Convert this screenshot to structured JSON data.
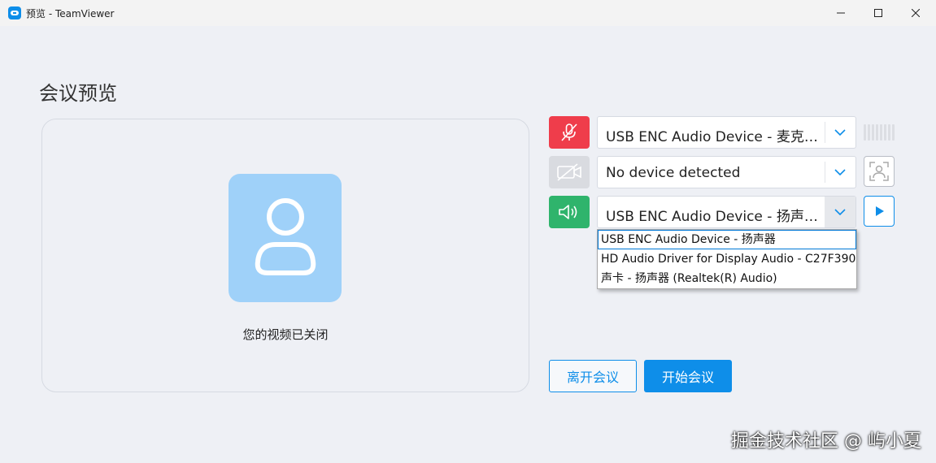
{
  "window": {
    "title": "预览 - TeamViewer"
  },
  "page": {
    "title": "会议预览"
  },
  "video": {
    "status": "您的视频已关闭"
  },
  "devices": {
    "microphone": {
      "value": "USB ENC Audio Device - 麦克风 (USB ENC Audio Device)",
      "muted": true,
      "icon": "mic-off-icon",
      "color": "#ef3d4b"
    },
    "camera": {
      "value": "No device detected",
      "icon": "camera-off-icon",
      "color": "#d9dbe0"
    },
    "speaker": {
      "value": "USB ENC Audio Device - 扬声器 (USB ENC Audio Device)",
      "icon": "speaker-icon",
      "color": "#2fb46c",
      "options": [
        "USB ENC Audio Device - 扬声器",
        "HD Audio Driver for Display Audio - C27F390",
        "声卡 - 扬声器 (Realtek(R) Audio)"
      ],
      "selected_index": 0
    }
  },
  "mic_level": 0,
  "buttons": {
    "leave": "离开会议",
    "start": "开始会议"
  },
  "watermark": "掘金技术社区 @ 屿小夏",
  "colors": {
    "accent": "#0e8ee9",
    "mic_muted": "#ef3d4b",
    "speaker": "#2fb46c",
    "avatar_bg": "#9fd1f9"
  }
}
